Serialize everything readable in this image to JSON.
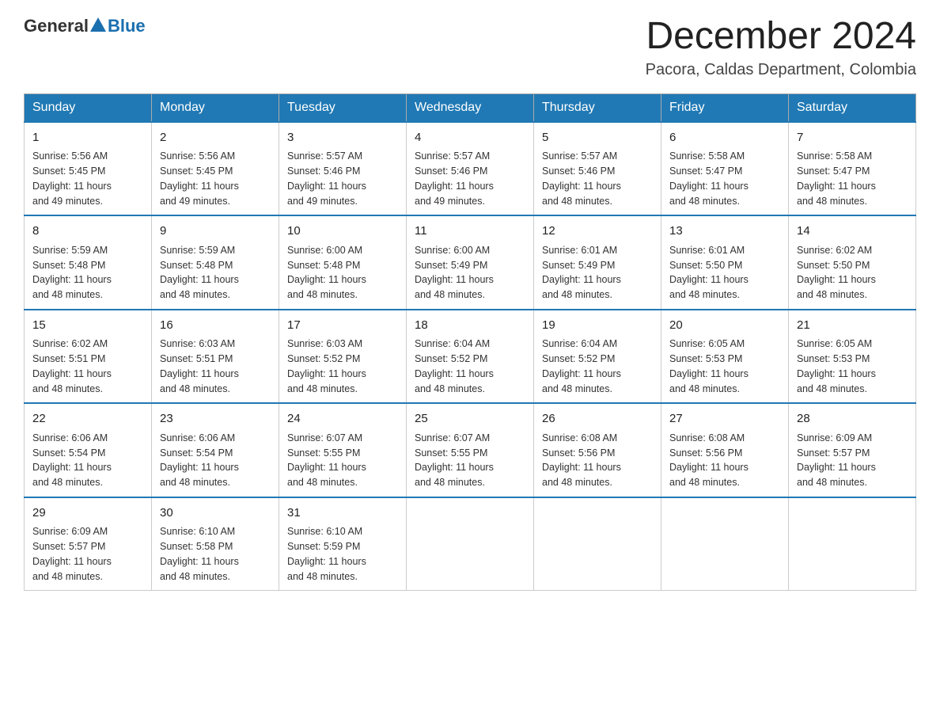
{
  "logo": {
    "text_general": "General",
    "text_blue": "Blue"
  },
  "title": "December 2024",
  "subtitle": "Pacora, Caldas Department, Colombia",
  "days_of_week": [
    "Sunday",
    "Monday",
    "Tuesday",
    "Wednesday",
    "Thursday",
    "Friday",
    "Saturday"
  ],
  "weeks": [
    [
      {
        "day": "1",
        "sunrise": "5:56 AM",
        "sunset": "5:45 PM",
        "daylight": "11 hours and 49 minutes."
      },
      {
        "day": "2",
        "sunrise": "5:56 AM",
        "sunset": "5:45 PM",
        "daylight": "11 hours and 49 minutes."
      },
      {
        "day": "3",
        "sunrise": "5:57 AM",
        "sunset": "5:46 PM",
        "daylight": "11 hours and 49 minutes."
      },
      {
        "day": "4",
        "sunrise": "5:57 AM",
        "sunset": "5:46 PM",
        "daylight": "11 hours and 49 minutes."
      },
      {
        "day": "5",
        "sunrise": "5:57 AM",
        "sunset": "5:46 PM",
        "daylight": "11 hours and 48 minutes."
      },
      {
        "day": "6",
        "sunrise": "5:58 AM",
        "sunset": "5:47 PM",
        "daylight": "11 hours and 48 minutes."
      },
      {
        "day": "7",
        "sunrise": "5:58 AM",
        "sunset": "5:47 PM",
        "daylight": "11 hours and 48 minutes."
      }
    ],
    [
      {
        "day": "8",
        "sunrise": "5:59 AM",
        "sunset": "5:48 PM",
        "daylight": "11 hours and 48 minutes."
      },
      {
        "day": "9",
        "sunrise": "5:59 AM",
        "sunset": "5:48 PM",
        "daylight": "11 hours and 48 minutes."
      },
      {
        "day": "10",
        "sunrise": "6:00 AM",
        "sunset": "5:48 PM",
        "daylight": "11 hours and 48 minutes."
      },
      {
        "day": "11",
        "sunrise": "6:00 AM",
        "sunset": "5:49 PM",
        "daylight": "11 hours and 48 minutes."
      },
      {
        "day": "12",
        "sunrise": "6:01 AM",
        "sunset": "5:49 PM",
        "daylight": "11 hours and 48 minutes."
      },
      {
        "day": "13",
        "sunrise": "6:01 AM",
        "sunset": "5:50 PM",
        "daylight": "11 hours and 48 minutes."
      },
      {
        "day": "14",
        "sunrise": "6:02 AM",
        "sunset": "5:50 PM",
        "daylight": "11 hours and 48 minutes."
      }
    ],
    [
      {
        "day": "15",
        "sunrise": "6:02 AM",
        "sunset": "5:51 PM",
        "daylight": "11 hours and 48 minutes."
      },
      {
        "day": "16",
        "sunrise": "6:03 AM",
        "sunset": "5:51 PM",
        "daylight": "11 hours and 48 minutes."
      },
      {
        "day": "17",
        "sunrise": "6:03 AM",
        "sunset": "5:52 PM",
        "daylight": "11 hours and 48 minutes."
      },
      {
        "day": "18",
        "sunrise": "6:04 AM",
        "sunset": "5:52 PM",
        "daylight": "11 hours and 48 minutes."
      },
      {
        "day": "19",
        "sunrise": "6:04 AM",
        "sunset": "5:52 PM",
        "daylight": "11 hours and 48 minutes."
      },
      {
        "day": "20",
        "sunrise": "6:05 AM",
        "sunset": "5:53 PM",
        "daylight": "11 hours and 48 minutes."
      },
      {
        "day": "21",
        "sunrise": "6:05 AM",
        "sunset": "5:53 PM",
        "daylight": "11 hours and 48 minutes."
      }
    ],
    [
      {
        "day": "22",
        "sunrise": "6:06 AM",
        "sunset": "5:54 PM",
        "daylight": "11 hours and 48 minutes."
      },
      {
        "day": "23",
        "sunrise": "6:06 AM",
        "sunset": "5:54 PM",
        "daylight": "11 hours and 48 minutes."
      },
      {
        "day": "24",
        "sunrise": "6:07 AM",
        "sunset": "5:55 PM",
        "daylight": "11 hours and 48 minutes."
      },
      {
        "day": "25",
        "sunrise": "6:07 AM",
        "sunset": "5:55 PM",
        "daylight": "11 hours and 48 minutes."
      },
      {
        "day": "26",
        "sunrise": "6:08 AM",
        "sunset": "5:56 PM",
        "daylight": "11 hours and 48 minutes."
      },
      {
        "day": "27",
        "sunrise": "6:08 AM",
        "sunset": "5:56 PM",
        "daylight": "11 hours and 48 minutes."
      },
      {
        "day": "28",
        "sunrise": "6:09 AM",
        "sunset": "5:57 PM",
        "daylight": "11 hours and 48 minutes."
      }
    ],
    [
      {
        "day": "29",
        "sunrise": "6:09 AM",
        "sunset": "5:57 PM",
        "daylight": "11 hours and 48 minutes."
      },
      {
        "day": "30",
        "sunrise": "6:10 AM",
        "sunset": "5:58 PM",
        "daylight": "11 hours and 48 minutes."
      },
      {
        "day": "31",
        "sunrise": "6:10 AM",
        "sunset": "5:59 PM",
        "daylight": "11 hours and 48 minutes."
      },
      null,
      null,
      null,
      null
    ]
  ],
  "labels": {
    "sunrise": "Sunrise:",
    "sunset": "Sunset:",
    "daylight": "Daylight:"
  }
}
